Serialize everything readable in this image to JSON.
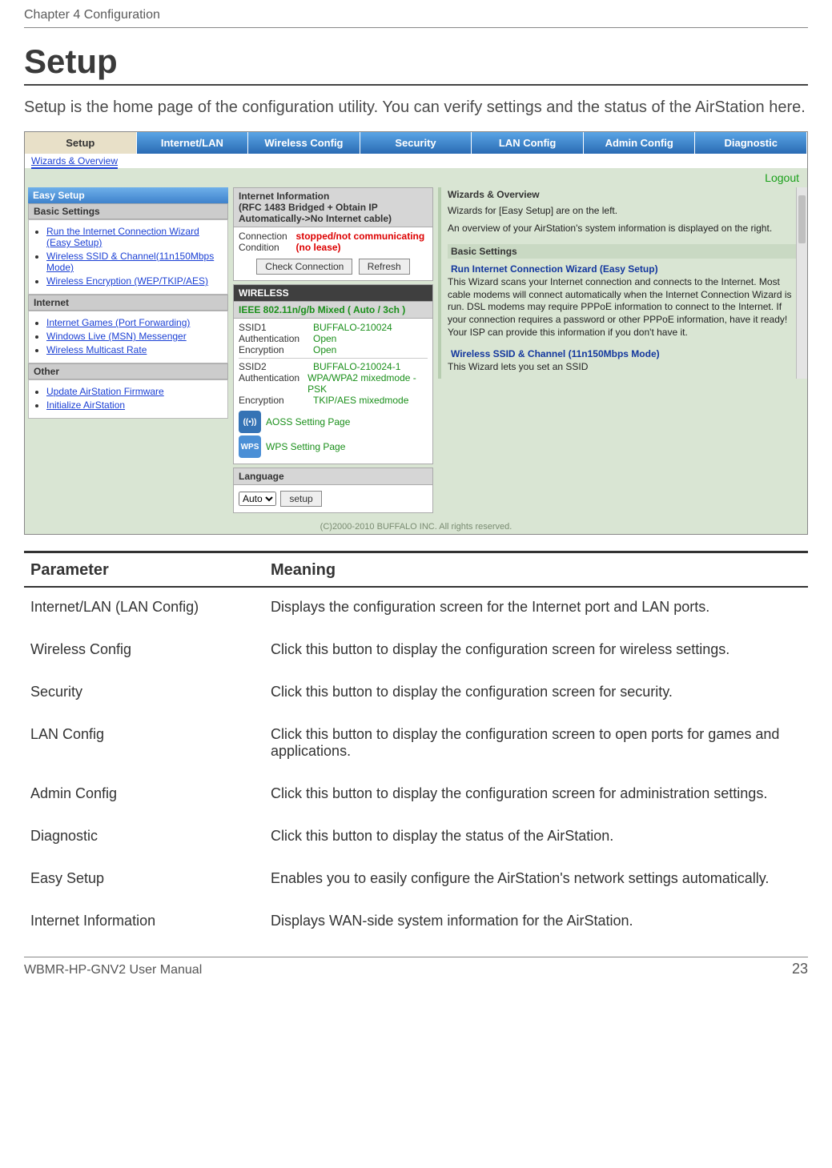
{
  "doc": {
    "chapter_header": "Chapter 4  Configuration",
    "title": "Setup",
    "lead": "Setup is the home page of the configuration utility. You can verify settings and the status of the AirStation here.",
    "footer_model": "WBMR-HP-GNV2 User Manual",
    "page_number": "23"
  },
  "shot": {
    "tabs": [
      "Setup",
      "Internet/LAN",
      "Wireless Config",
      "Security",
      "LAN Config",
      "Admin Config",
      "Diagnostic"
    ],
    "subnav": "Wizards & Overview",
    "logout": "Logout",
    "left": {
      "panel_title": "Easy Setup",
      "groups": [
        {
          "header": "Basic Settings",
          "links": [
            "Run the Internet Connection Wizard (Easy Setup)",
            "Wireless SSID & Channel(11n150Mbps Mode)",
            "Wireless Encryption (WEP/TKIP/AES)"
          ]
        },
        {
          "header": "Internet",
          "links": [
            "Internet Games (Port Forwarding)",
            "Windows Live (MSN) Messenger",
            "Wireless Multicast Rate"
          ]
        },
        {
          "header": "Other",
          "links": [
            "Update AirStation Firmware",
            "Initialize AirStation"
          ]
        }
      ]
    },
    "mid": {
      "internet_header": "Internet Information",
      "internet_sub": "(RFC 1483 Bridged + Obtain IP Automatically->No Internet cable)",
      "conn_label": "Connection Condition",
      "conn_value": "stopped/not communicating (no lease)",
      "btn_check": "Check Connection",
      "btn_refresh": "Refresh",
      "wireless_header": "WIRELESS",
      "wireless_mode": "IEEE 802.11n/g/b Mixed ( Auto / 3ch )",
      "rows": [
        {
          "k": "SSID1",
          "v": "BUFFALO-210024"
        },
        {
          "k": "Authentication",
          "v": "Open"
        },
        {
          "k": "Encryption",
          "v": "Open"
        },
        {
          "k": "SSID2",
          "v": "BUFFALO-210024-1"
        },
        {
          "k": "Authentication",
          "v": "WPA/WPA2 mixedmode - PSK"
        },
        {
          "k": "Encryption",
          "v": "TKIP/AES mixedmode"
        }
      ],
      "aoss_label": "AOSS Setting Page",
      "wps_label": "WPS Setting Page",
      "lang_header": "Language",
      "lang_value": "Auto",
      "lang_btn": "setup"
    },
    "right": {
      "title": "Wizards & Overview",
      "p1": "Wizards for [Easy Setup] are on the left.",
      "p2": "An overview of your AirStation's system information is displayed on the right.",
      "bs_header": "Basic Settings",
      "run_title": "Run Internet Connection Wizard (Easy Setup)",
      "run_body": "This Wizard scans your Internet connection and connects to the Internet. Most cable modems will connect automatically when the Internet Connection Wizard is run. DSL modems may require PPPoE information to connect to the Internet. If your connection requires a password or other PPPoE information, have it ready! Your ISP can provide this information if you don't have it.",
      "ssid_title": "Wireless SSID & Channel (11n150Mbps Mode)",
      "ssid_body": "This Wizard lets you set an SSID"
    },
    "copyright": "(C)2000-2010 BUFFALO INC. All rights reserved."
  },
  "table": {
    "h_param": "Parameter",
    "h_meaning": "Meaning",
    "rows": [
      {
        "p": "Internet/LAN (LAN Config)",
        "m": "Displays the configuration screen for the Internet port and LAN ports."
      },
      {
        "p": "Wireless Config",
        "m": "Click this button to display the configuration screen for wireless settings."
      },
      {
        "p": "Security",
        "m": "Click this button to display the configuration screen for security."
      },
      {
        "p": "LAN Config",
        "m": "Click this button to display the configuration screen to open ports for games and applications."
      },
      {
        "p": "Admin Config",
        "m": "Click this button to display the configuration screen for administration settings."
      },
      {
        "p": "Diagnostic",
        "m": "Click this button to display the status of the AirStation."
      },
      {
        "p": "Easy Setup",
        "m": "Enables you to easily configure the AirStation's network settings automatically."
      },
      {
        "p": "Internet Information",
        "m": "Displays WAN-side system information for the AirStation."
      }
    ]
  }
}
